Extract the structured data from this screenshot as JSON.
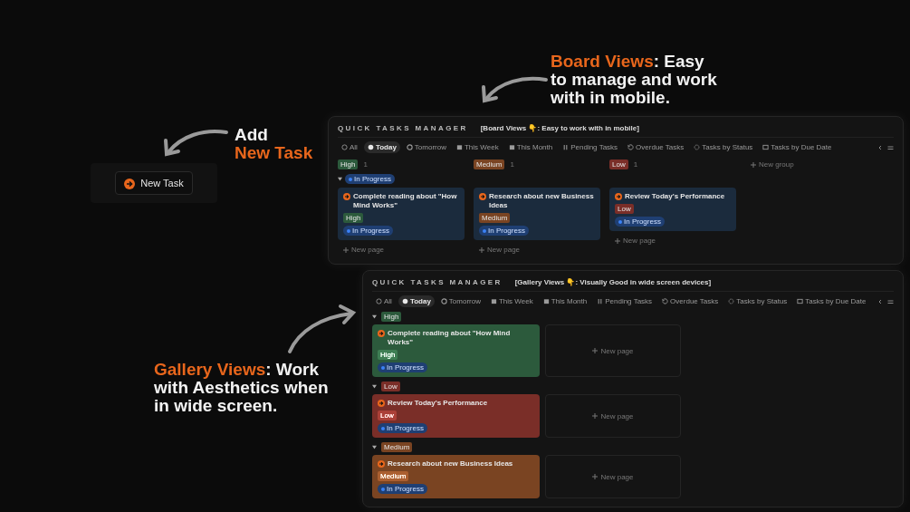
{
  "callouts": [
    {
      "kind": "add",
      "lines": [
        [
          {
            "text": "Add",
            "accent": false
          }
        ],
        [
          {
            "text": "New Task",
            "accent": true
          }
        ]
      ]
    },
    {
      "kind": "board",
      "lines": [
        [
          {
            "text": "Board Views",
            "accent": true
          },
          {
            "text": ": Easy",
            "accent": false
          }
        ],
        [
          {
            "text": "to manage and work",
            "accent": false
          }
        ],
        [
          {
            "text": "with in mobile.",
            "accent": false
          }
        ]
      ]
    },
    {
      "kind": "gallery",
      "lines": [
        [
          {
            "text": "Gallery Views",
            "accent": true
          },
          {
            "text": ": Work",
            "accent": false
          }
        ],
        [
          {
            "text": "with Aesthetics when",
            "accent": false
          }
        ],
        [
          {
            "text": "in wide screen.",
            "accent": false
          }
        ]
      ]
    }
  ],
  "new_task_button": {
    "label": "New Task"
  },
  "views": [
    {
      "kind": "board",
      "title": "QUICK TASKS MANAGER",
      "subtitle": "[Board Views 👇: Easy to work with in mobile]",
      "tabs": [
        {
          "label": "All",
          "selected": false
        },
        {
          "label": "Today",
          "selected": true
        },
        {
          "label": "Tomorrow",
          "selected": false
        },
        {
          "label": "This Week",
          "selected": false
        },
        {
          "label": "This Month",
          "selected": false
        },
        {
          "label": "Pending Tasks",
          "selected": false
        },
        {
          "label": "Overdue Tasks",
          "selected": false
        },
        {
          "label": "Tasks by Status",
          "selected": false
        },
        {
          "label": "Tasks by Due Date",
          "selected": false
        }
      ],
      "status_group": {
        "label": "In Progress",
        "expanded": true
      },
      "groups": [
        {
          "label": "High",
          "count": "1",
          "color": "#2c5a3c",
          "cards": [
            {
              "title": "Complete reading about \"How Mind Works\"",
              "priority": "High",
              "status": "In Progress"
            }
          ],
          "new_page": "New page"
        },
        {
          "label": "Medium",
          "count": "1",
          "color": "#7a4422",
          "cards": [
            {
              "title": "Research about new Business Ideas",
              "priority": "Medium",
              "status": "In Progress"
            }
          ],
          "new_page": "New page"
        },
        {
          "label": "Low",
          "count": "1",
          "color": "#7a2e28",
          "cards": [
            {
              "title": "Review Today's Performance",
              "priority": "Low",
              "status": "In Progress"
            }
          ],
          "new_page": "New page"
        }
      ],
      "new_group": "New group"
    },
    {
      "kind": "gallery",
      "title": "QUICK TASKS MANAGER",
      "subtitle": "[Gallery Views 👇: Visually Good in wide screen devices]",
      "tabs": [
        {
          "label": "All",
          "selected": false
        },
        {
          "label": "Today",
          "selected": true
        },
        {
          "label": "Tomorrow",
          "selected": false
        },
        {
          "label": "This Week",
          "selected": false
        },
        {
          "label": "This Month",
          "selected": false
        },
        {
          "label": "Pending Tasks",
          "selected": false
        },
        {
          "label": "Overdue Tasks",
          "selected": false
        },
        {
          "label": "Tasks by Status",
          "selected": false
        },
        {
          "label": "Tasks by Due Date",
          "selected": false
        }
      ],
      "groups": [
        {
          "label": "High",
          "color": "#2c5a3c",
          "cards": [
            {
              "title": "Complete reading about \"How Mind Works\"",
              "priority": "High",
              "status": "In Progress"
            }
          ],
          "new_page": "New page"
        },
        {
          "label": "Low",
          "color": "#7a2e28",
          "cards": [
            {
              "title": "Review Today's Performance",
              "priority": "Low",
              "status": "In Progress"
            }
          ],
          "new_page": "New page"
        },
        {
          "label": "Medium",
          "color": "#7a4422",
          "cards": [
            {
              "title": "Research about new Business Ideas",
              "priority": "Medium",
              "status": "In Progress"
            }
          ],
          "new_page": "New page"
        }
      ]
    }
  ]
}
